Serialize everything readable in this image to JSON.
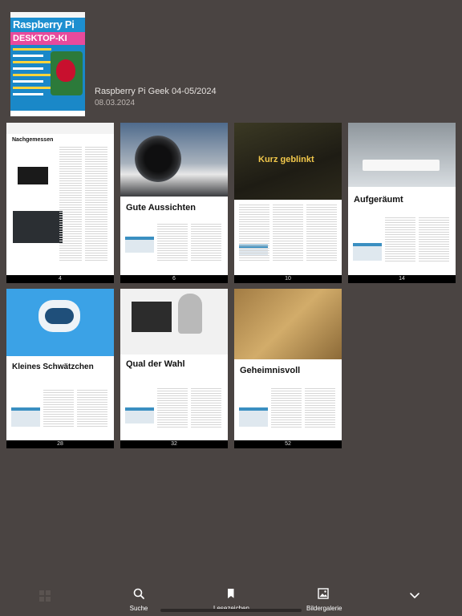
{
  "issue": {
    "cover_brand": "Raspberry Pi",
    "cover_headline": "DESKTOP-KI",
    "title": "Raspberry Pi Geek 04-05/2024",
    "date": "08.03.2024"
  },
  "pages": [
    {
      "number": "4",
      "title": "Nachgemessen",
      "photo_color": "#ffffff",
      "accent": "#c8102e"
    },
    {
      "number": "6",
      "title": "Gute Aussichten",
      "photo_color": "#5a6e86",
      "accent": "#3a8fc1"
    },
    {
      "number": "10",
      "title": "Kurz geblinkt",
      "photo_color": "#2b2a1f",
      "accent": "#3a8fc1"
    },
    {
      "number": "14",
      "title": "Aufgeräumt",
      "photo_color": "#c9ced3",
      "accent": "#3a8fc1"
    },
    {
      "number": "28",
      "title": "Kleines Schwätzchen",
      "photo_color": "#3aa0e4",
      "accent": "#3a8fc1"
    },
    {
      "number": "32",
      "title": "Qual der Wahl",
      "photo_color": "#e9e9e9",
      "accent": "#3a8fc1"
    },
    {
      "number": "52",
      "title": "Geheimnisvoll",
      "photo_color": "#b08a4c",
      "accent": "#3a8fc1"
    }
  ],
  "toolbar": {
    "search_label": "Suche",
    "bookmarks_label": "Lesezeichen",
    "gallery_label": "Bildergalerie"
  },
  "colors": {
    "background": "#4a4442",
    "cover_blue": "#1d8fd0",
    "toolbar_icon": "#ffffff"
  }
}
